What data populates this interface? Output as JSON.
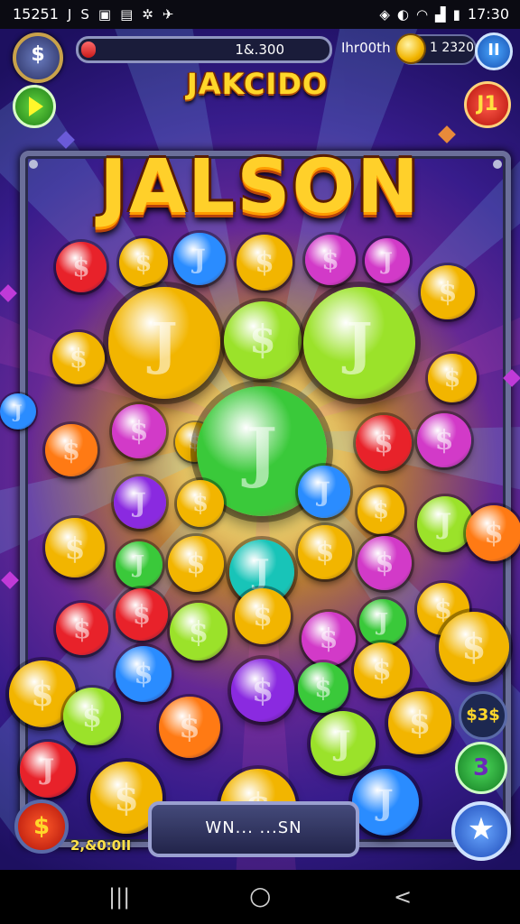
{
  "status_bar": {
    "time_left": "15251",
    "left_icons": [
      "app-icon-j",
      "app-icon-s",
      "app-icon-image",
      "app-icon-gallery",
      "settings-icon",
      "bird-icon"
    ],
    "right_icons": [
      "vibrate-icon",
      "wifi-icon",
      "signal-icon"
    ],
    "battery": "",
    "time_right": "17:30"
  },
  "hud": {
    "badge_symbol": "$",
    "progress_text": "1&.300",
    "progress_fraction": 0.06,
    "coins_label": "Ihr00th",
    "coins_value": "1 2320",
    "pause_label": "II",
    "level_label": "J1"
  },
  "title": {
    "subtitle": "JAKCIDO",
    "logo": "JALSON"
  },
  "bottom": {
    "panel_text": "WN... ...SN",
    "left_button_symbol": "$",
    "left_counter": "2,&0:0II",
    "side_button_top": "$3$",
    "side_button_bottom": "3",
    "star_symbol": "★"
  },
  "nav_bar": {
    "recent": "|||",
    "home": "○",
    "back": "<"
  },
  "colors": {
    "gold": "#f2b500",
    "green": "#3ac93a",
    "blue": "#2a8cff",
    "red": "#e8222a",
    "magenta": "#d23ac8",
    "orange": "#ff7a14",
    "lime": "#9be22a",
    "teal": "#18c4b8",
    "purple": "#8a2ae0"
  }
}
